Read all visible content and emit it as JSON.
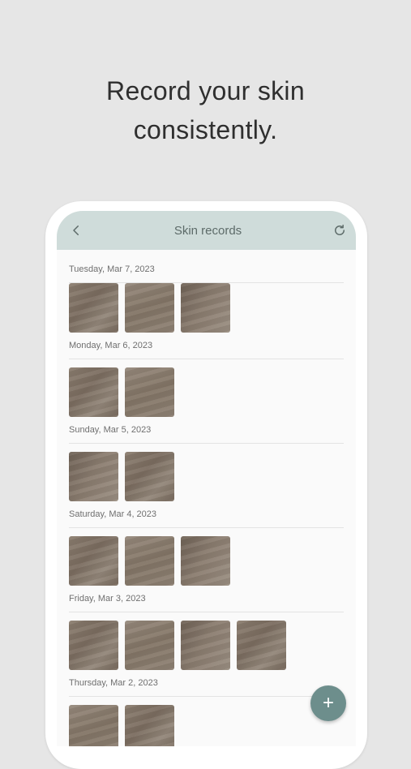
{
  "headline": {
    "line1": "Record your skin",
    "line2": "consistently."
  },
  "appbar": {
    "title": "Skin records",
    "back_icon": "chevron-left-icon",
    "refresh_icon": "refresh-icon"
  },
  "days": [
    {
      "label": "Tuesday, Mar 7, 2023",
      "photos": 3
    },
    {
      "label": "Monday, Mar 6, 2023",
      "photos": 2
    },
    {
      "label": "Sunday, Mar 5, 2023",
      "photos": 2
    },
    {
      "label": "Saturday, Mar 4, 2023",
      "photos": 3
    },
    {
      "label": "Friday, Mar 3, 2023",
      "photos": 4
    },
    {
      "label": "Thursday, Mar 2, 2023",
      "photos": 2
    }
  ],
  "fab": {
    "label": "+",
    "icon": "plus-icon"
  },
  "colors": {
    "background": "#e6e6e6",
    "appbar": "#cfdcda",
    "accent": "#6d8e8c"
  }
}
